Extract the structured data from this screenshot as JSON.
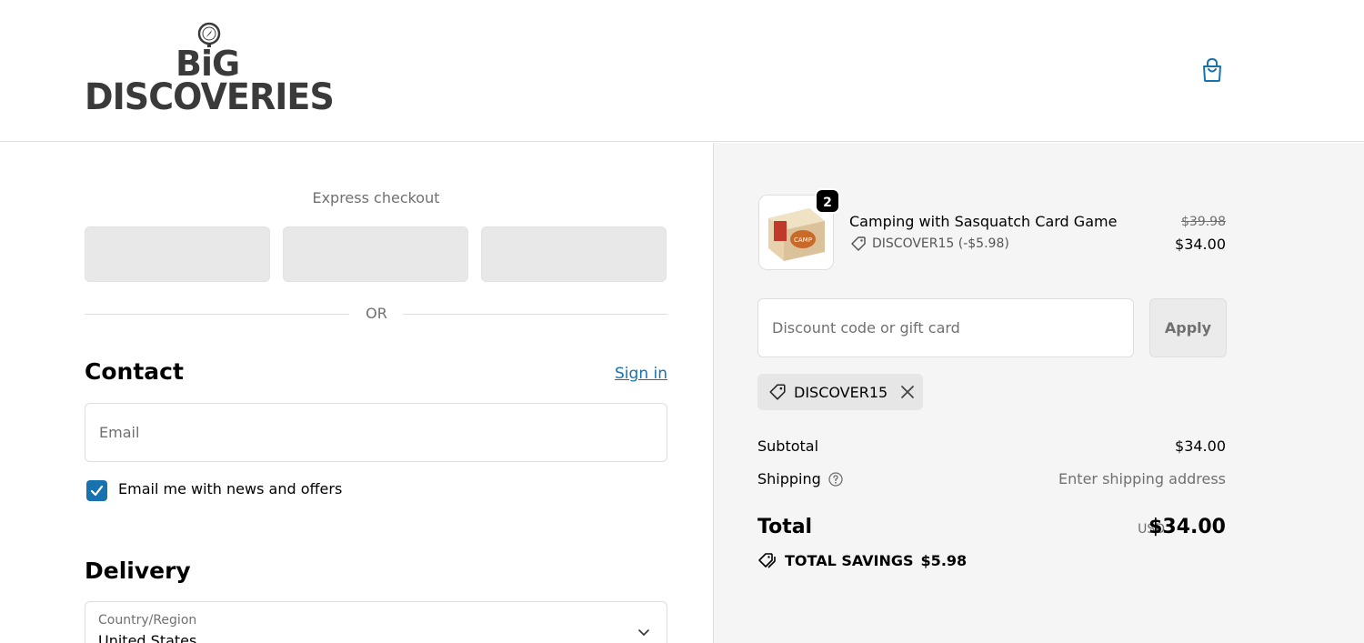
{
  "brand": {
    "line1": "BiG",
    "line2": "DISCOVERIES"
  },
  "header": {
    "cart_icon": "shopping-bag-icon",
    "accent": "#1773b0"
  },
  "express": {
    "title": "Express checkout",
    "divider": "OR"
  },
  "contact": {
    "heading": "Contact",
    "signin_label": "Sign in",
    "email_placeholder": "Email",
    "newsletter_label": "Email me with news and offers",
    "newsletter_checked": true
  },
  "delivery": {
    "heading": "Delivery",
    "country_label": "Country/Region",
    "country_value": "United States"
  },
  "cart": {
    "item": {
      "quantity": "2",
      "name": "Camping with Sasquatch Card Game",
      "discount": "DISCOVER15 (-$5.98)",
      "price_original": "$39.98",
      "price_final": "$34.00"
    },
    "discount_placeholder": "Discount code or gift card",
    "apply_label": "Apply",
    "applied_code": "DISCOVER15",
    "subtotal_label": "Subtotal",
    "subtotal_value": "$34.00",
    "shipping_label": "Shipping",
    "shipping_value": "Enter shipping address",
    "total_label": "Total",
    "currency": "USD",
    "total_value": "$34.00",
    "savings_label": "TOTAL SAVINGS",
    "savings_value": "$5.98"
  }
}
